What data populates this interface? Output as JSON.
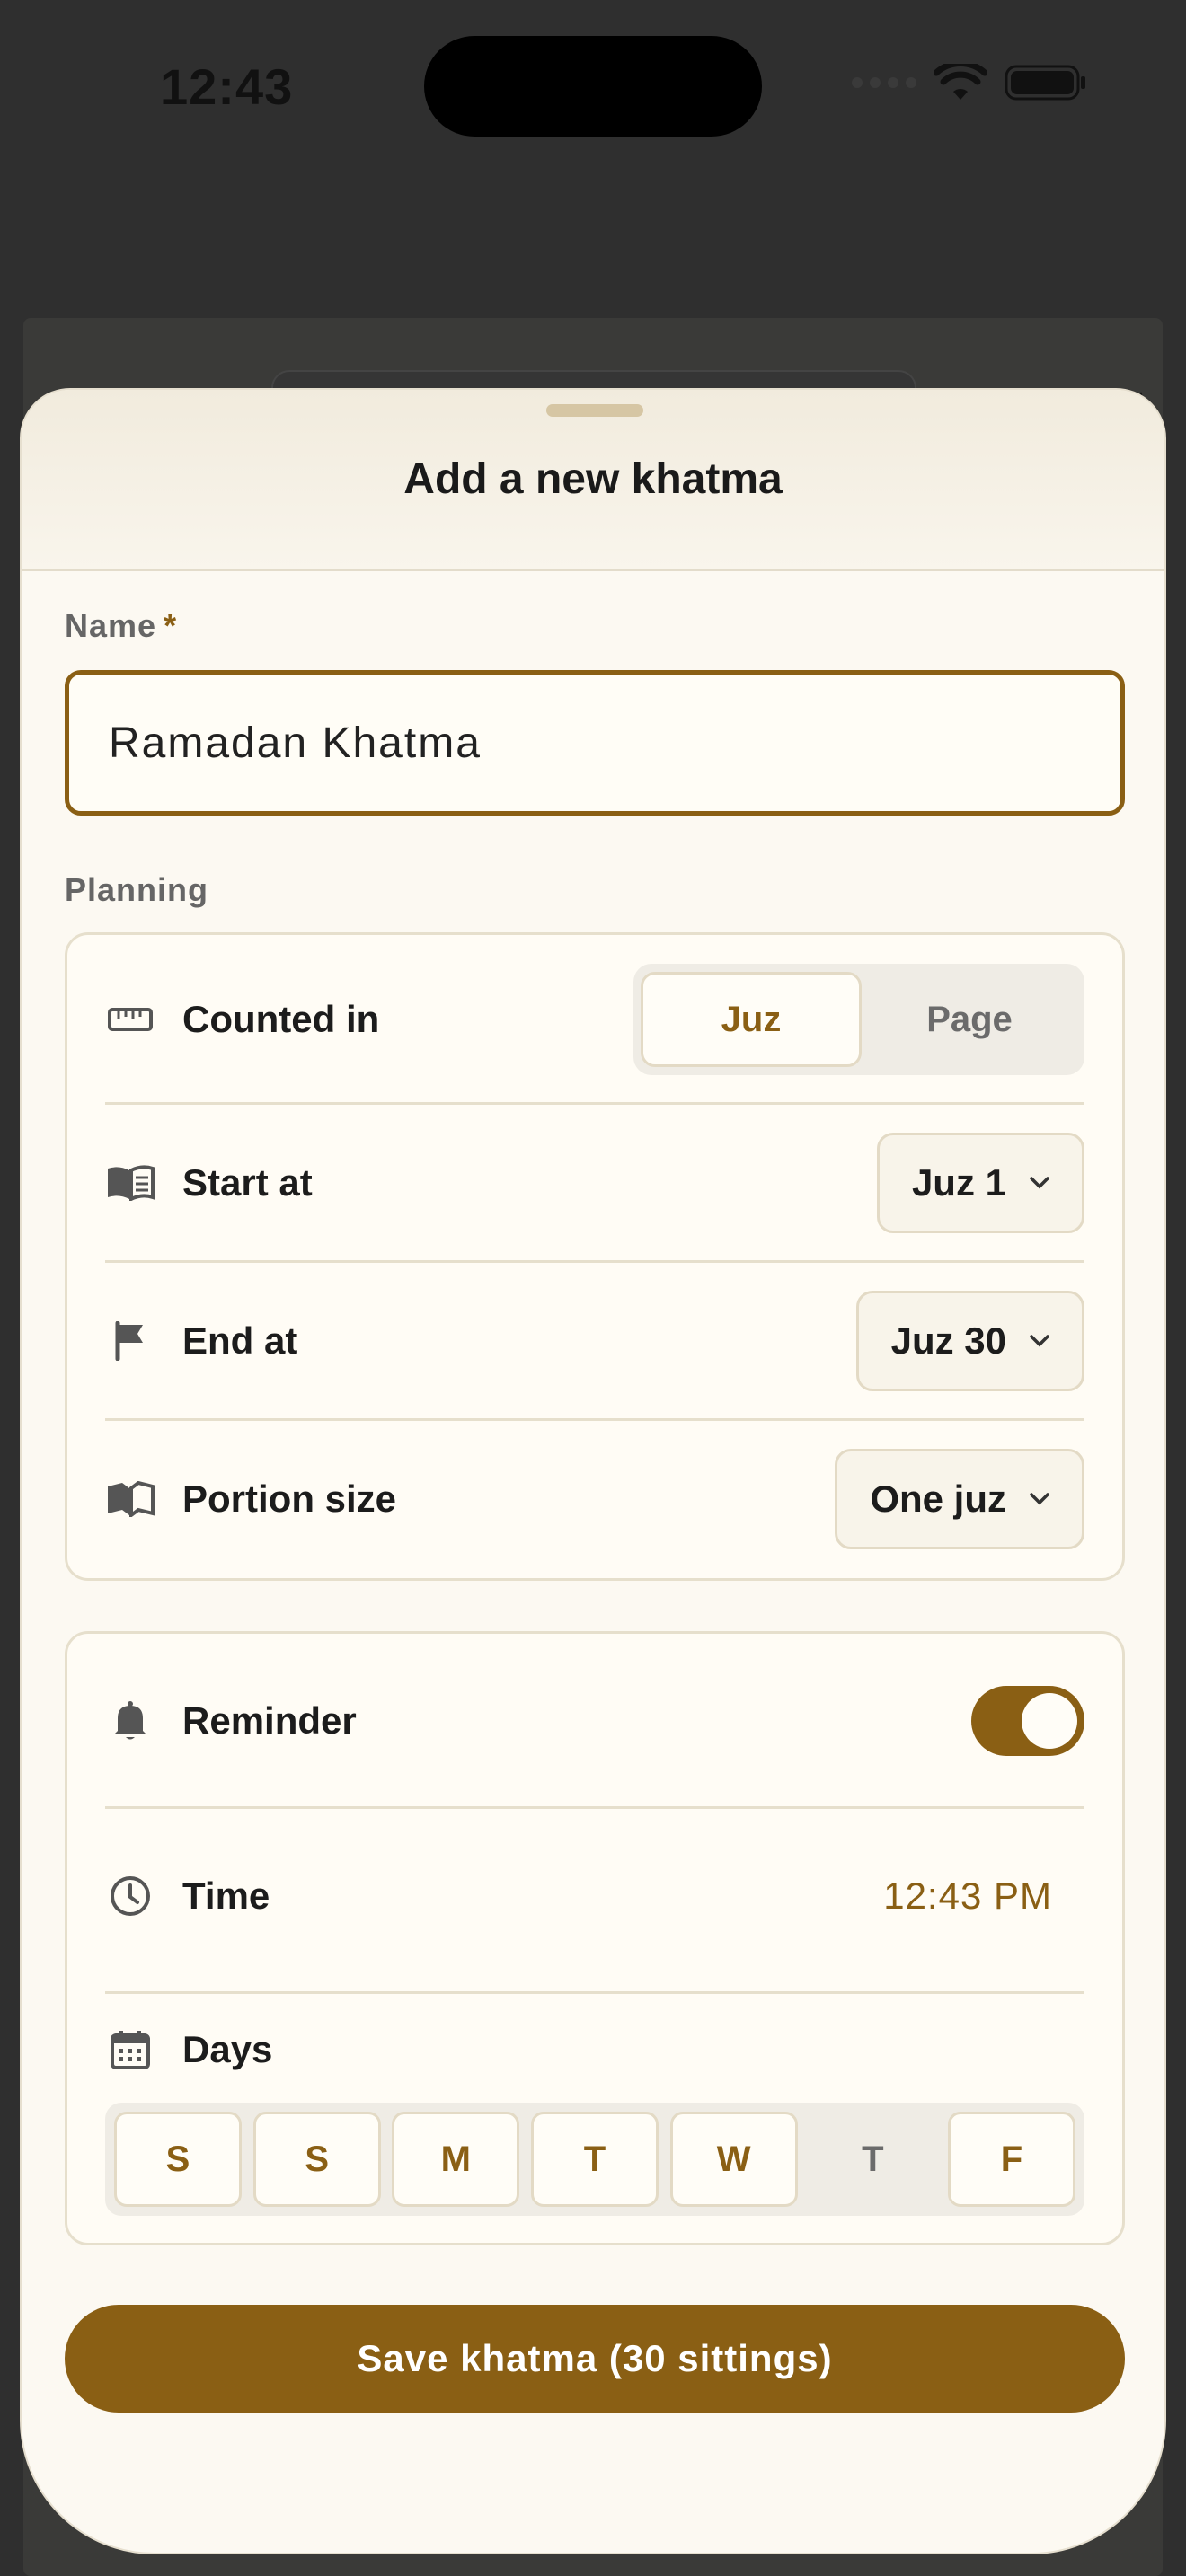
{
  "status_bar": {
    "time": "12:43"
  },
  "sheet": {
    "title": "Add a new khatma",
    "name_label": "Name",
    "required_mark": "*",
    "name_value": "Ramadan Khatma",
    "planning_label": "Planning",
    "counted_in": {
      "label": "Counted in",
      "options": [
        "Juz",
        "Page"
      ],
      "selected": "Juz"
    },
    "start_at": {
      "label": "Start at",
      "value": "Juz 1"
    },
    "end_at": {
      "label": "End at",
      "value": "Juz 30"
    },
    "portion_size": {
      "label": "Portion size",
      "value": "One juz"
    },
    "reminder": {
      "label": "Reminder",
      "enabled": true
    },
    "time": {
      "label": "Time",
      "value": "12:43 PM"
    },
    "days": {
      "label": "Days",
      "items": [
        {
          "letter": "S",
          "selected": true
        },
        {
          "letter": "S",
          "selected": true
        },
        {
          "letter": "M",
          "selected": true
        },
        {
          "letter": "T",
          "selected": true
        },
        {
          "letter": "W",
          "selected": true
        },
        {
          "letter": "T",
          "selected": false
        },
        {
          "letter": "F",
          "selected": true
        }
      ]
    },
    "save_label": "Save khatma (30 sittings)"
  },
  "colors": {
    "accent": "#8a5f14",
    "sheet_bg": "#fcf9f2",
    "overlay": "#2f2f2f"
  },
  "icons": [
    "menu-icon",
    "book-icon",
    "bookmark-add-icon",
    "play-icon",
    "edit-icon",
    "share-icon",
    "sparkle-icon",
    "ruler-icon",
    "book-open-icon",
    "flag-icon",
    "map-book-icon",
    "bell-icon",
    "clock-icon",
    "calendar-icon",
    "chevron-down-icon"
  ]
}
